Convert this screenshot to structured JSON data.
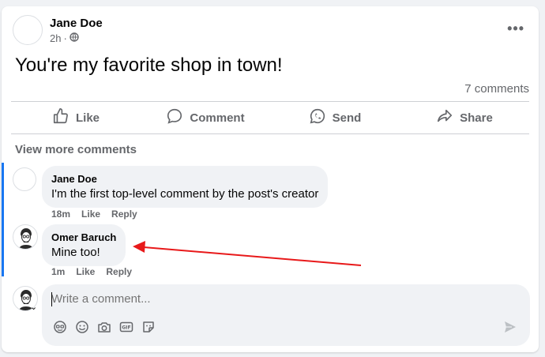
{
  "post": {
    "author": "Jane Doe",
    "time": "2h",
    "text": "You're my favorite shop in town!",
    "comment_count": "7 comments"
  },
  "actions": {
    "like": "Like",
    "comment": "Comment",
    "send": "Send",
    "share": "Share"
  },
  "comments_section": {
    "view_more": "View more comments",
    "items": [
      {
        "author": "Jane Doe",
        "text": "I'm the first top-level comment by the post's creator",
        "time": "18m",
        "like": "Like",
        "reply": "Reply"
      },
      {
        "author": "Omer Baruch",
        "text": "Mine too!",
        "time": "1m",
        "like": "Like",
        "reply": "Reply"
      }
    ]
  },
  "composer": {
    "placeholder": "Write a comment..."
  },
  "colors": {
    "accent": "#1877f2",
    "annotation_arrow": "#e8191a"
  },
  "icons": [
    "globe-icon",
    "more-icon",
    "like-icon",
    "comment-icon",
    "send-icon",
    "share-icon",
    "avatar-sticker-icon",
    "emoji-icon",
    "camera-icon",
    "gif-icon",
    "sticker-icon",
    "submit-icon",
    "chevron-down-icon"
  ]
}
